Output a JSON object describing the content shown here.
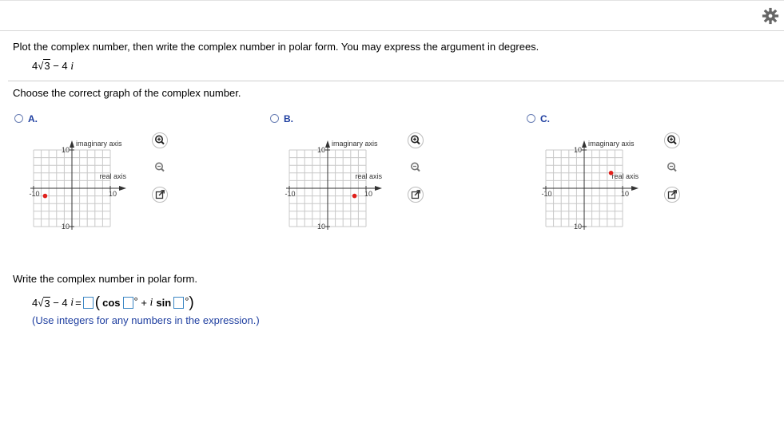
{
  "question": {
    "instruction": "Plot the complex number, then write the complex number in polar form. You may express the argument in degrees.",
    "expr_coef": "4",
    "expr_radicand": "3",
    "expr_rest": " − 4 ",
    "imag_unit": "i"
  },
  "part1": {
    "prompt": "Choose the correct graph of the complex number.",
    "options": [
      {
        "letter": "A.",
        "selected": false,
        "point": {
          "x": -7,
          "y": -2
        }
      },
      {
        "letter": "B.",
        "selected": false,
        "point": {
          "x": 7,
          "y": -2
        }
      },
      {
        "letter": "C.",
        "selected": false,
        "point": {
          "x": 7,
          "y": 4
        }
      }
    ],
    "axes": {
      "imag_label": "imaginary axis",
      "real_label": "real axis",
      "tick_pos": "10",
      "tick_neg": "-10",
      "range": [
        -10,
        10
      ],
      "grid_step": 2
    },
    "tools": [
      "zoom-in-icon",
      "zoom-out-icon",
      "popout-icon"
    ]
  },
  "part2": {
    "prompt": "Write the complex number in polar form.",
    "lhs_rest": " − 4 ",
    "equals": "=",
    "cos_label": "cos",
    "degree": "°",
    "plus": " + ",
    "sin_label": "sin",
    "hint": "(Use integers for any numbers in the expression.)"
  },
  "colors": {
    "point": "#e0201b",
    "grid": "#c8c8c8",
    "accent": "#1f3fa0",
    "input_border": "#3b86c4"
  }
}
